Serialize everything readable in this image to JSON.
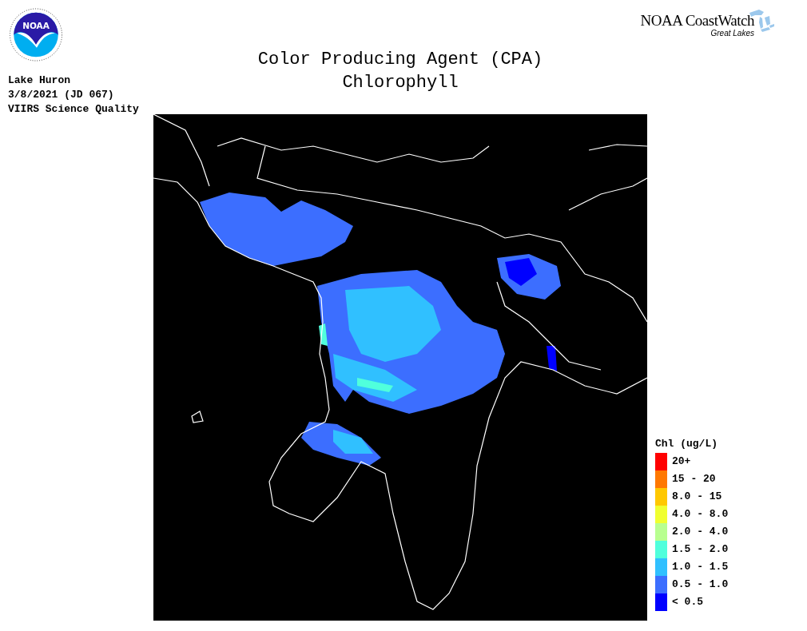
{
  "logo": {
    "text": "NOAA"
  },
  "brand": {
    "name": "NOAA CoastWatch",
    "subtitle": "Great Lakes"
  },
  "title": [
    "Color Producing Agent (CPA)",
    "Chlorophyll"
  ],
  "info": [
    "Lake Huron",
    "3/8/2021 (JD 067)",
    "VIIRS Science Quality"
  ],
  "legend": {
    "title": "Chl (ug/L)",
    "items": [
      {
        "label": "20+",
        "color": "#ff0000"
      },
      {
        "label": "15 - 20",
        "color": "#ff7800"
      },
      {
        "label": "8.0 - 15",
        "color": "#ffc800"
      },
      {
        "label": "4.0 - 8.0",
        "color": "#f0ff30"
      },
      {
        "label": "2.0 - 4.0",
        "color": "#b8ff90"
      },
      {
        "label": "1.5 - 2.0",
        "color": "#50ffdc"
      },
      {
        "label": "1.0 - 1.5",
        "color": "#30c0ff"
      },
      {
        "label": "0.5 - 1.0",
        "color": "#3c6eff"
      },
      {
        "label": "< 0.5",
        "color": "#0000ff"
      }
    ]
  }
}
